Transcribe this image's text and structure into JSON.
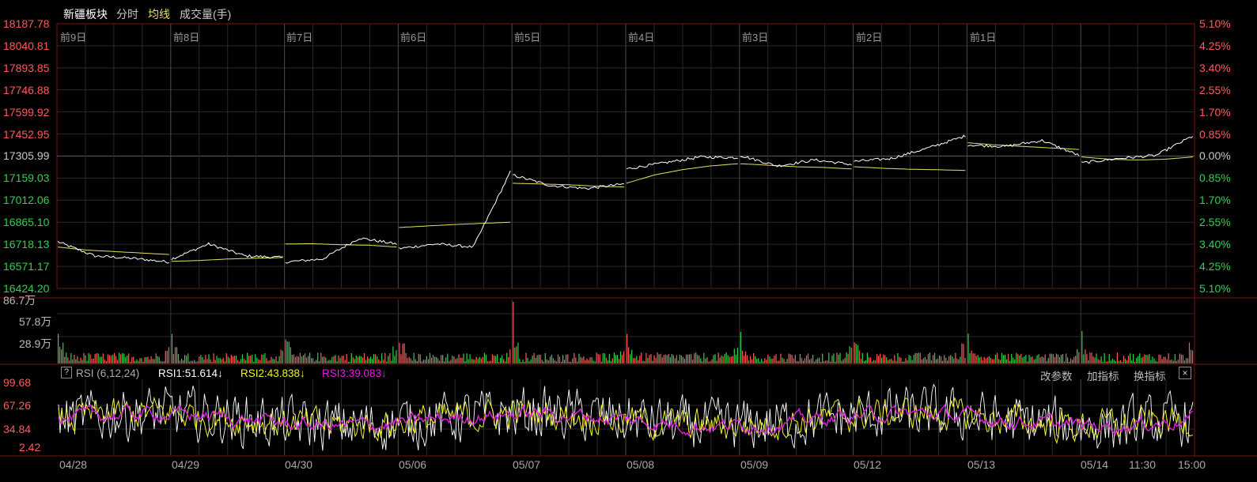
{
  "header": {
    "title": "新疆板块",
    "tab_minute": "分时",
    "tab_avgline": "均线",
    "tab_volume": "成交量(手)"
  },
  "colors": {
    "up": "#ff5a5a",
    "down": "#2fd14e",
    "price_line": "#ffffff",
    "avg_line": "#e7df5a",
    "rsi1": "#ffffff",
    "rsi2": "#f2f22a",
    "rsi3": "#e020e0",
    "grid": "#2a2a2a",
    "separator": "#7a1515"
  },
  "price_axis": {
    "left_labels": [
      "18187.78",
      "18040.81",
      "17893.85",
      "17746.88",
      "17599.92",
      "17452.95",
      "17305.99",
      "17159.03",
      "17012.06",
      "16865.10",
      "16718.13",
      "16571.17",
      "16424.20"
    ],
    "right_labels": [
      "5.10%",
      "4.25%",
      "3.40%",
      "2.55%",
      "1.70%",
      "0.85%",
      "0.00%",
      "0.85%",
      "1.70%",
      "2.55%",
      "3.40%",
      "4.25%",
      "5.10%"
    ]
  },
  "day_labels": [
    "前9日",
    "前8日",
    "前7日",
    "前6日",
    "前5日",
    "前4日",
    "前3日",
    "前2日",
    "前1日"
  ],
  "volume_axis": [
    "86.7万",
    "57.8万",
    "28.9万"
  ],
  "rsi_panel": {
    "help": "?",
    "title": "RSI (6,12,24)",
    "rsi1": "RSI1:51.614↓",
    "rsi2": "RSI2:43.838↓",
    "rsi3": "RSI3:39.083↓",
    "btn_params": "改参数",
    "btn_add": "加指标",
    "btn_switch": "换指标",
    "btn_close": "×",
    "axis": [
      "99.68",
      "67.26",
      "34.84",
      "2.42"
    ]
  },
  "date_labels": [
    "04/28",
    "04/29",
    "04/30",
    "05/06",
    "05/07",
    "05/08",
    "05/09",
    "05/12",
    "05/13",
    "05/14",
    "11:30",
    "15:00"
  ],
  "chart_data": {
    "type": "line",
    "title": "新疆板块",
    "ylim": [
      16424.2,
      18187.78
    ],
    "series": [
      {
        "name": "分时",
        "values": [
          16735,
          16640,
          16625,
          16600,
          16620,
          16720,
          16640,
          16630,
          16600,
          16620,
          16760,
          16720,
          16690,
          16720,
          16700,
          17200,
          17180,
          17110,
          17090,
          17120,
          17220,
          17260,
          17300,
          17295,
          17310,
          17240,
          17280,
          17250,
          17270,
          17290,
          17360,
          17440,
          17380,
          17370,
          17410,
          17310,
          17260,
          17290,
          17310,
          17440
        ]
      },
      {
        "name": "均线",
        "values": [
          16700,
          16680,
          16670,
          16660,
          16650,
          16605,
          16610,
          16620,
          16625,
          16630,
          16720,
          16722,
          16715,
          16712,
          16700,
          16830,
          16840,
          16850,
          16858,
          16865,
          17125,
          17120,
          17115,
          17105,
          17100,
          17125,
          17180,
          17215,
          17240,
          17255,
          17255,
          17245,
          17235,
          17230,
          17220,
          17235,
          17225,
          17218,
          17215,
          17210,
          17395,
          17380,
          17370,
          17360,
          17350,
          17300,
          17285,
          17280,
          17285,
          17300
        ]
      }
    ]
  }
}
